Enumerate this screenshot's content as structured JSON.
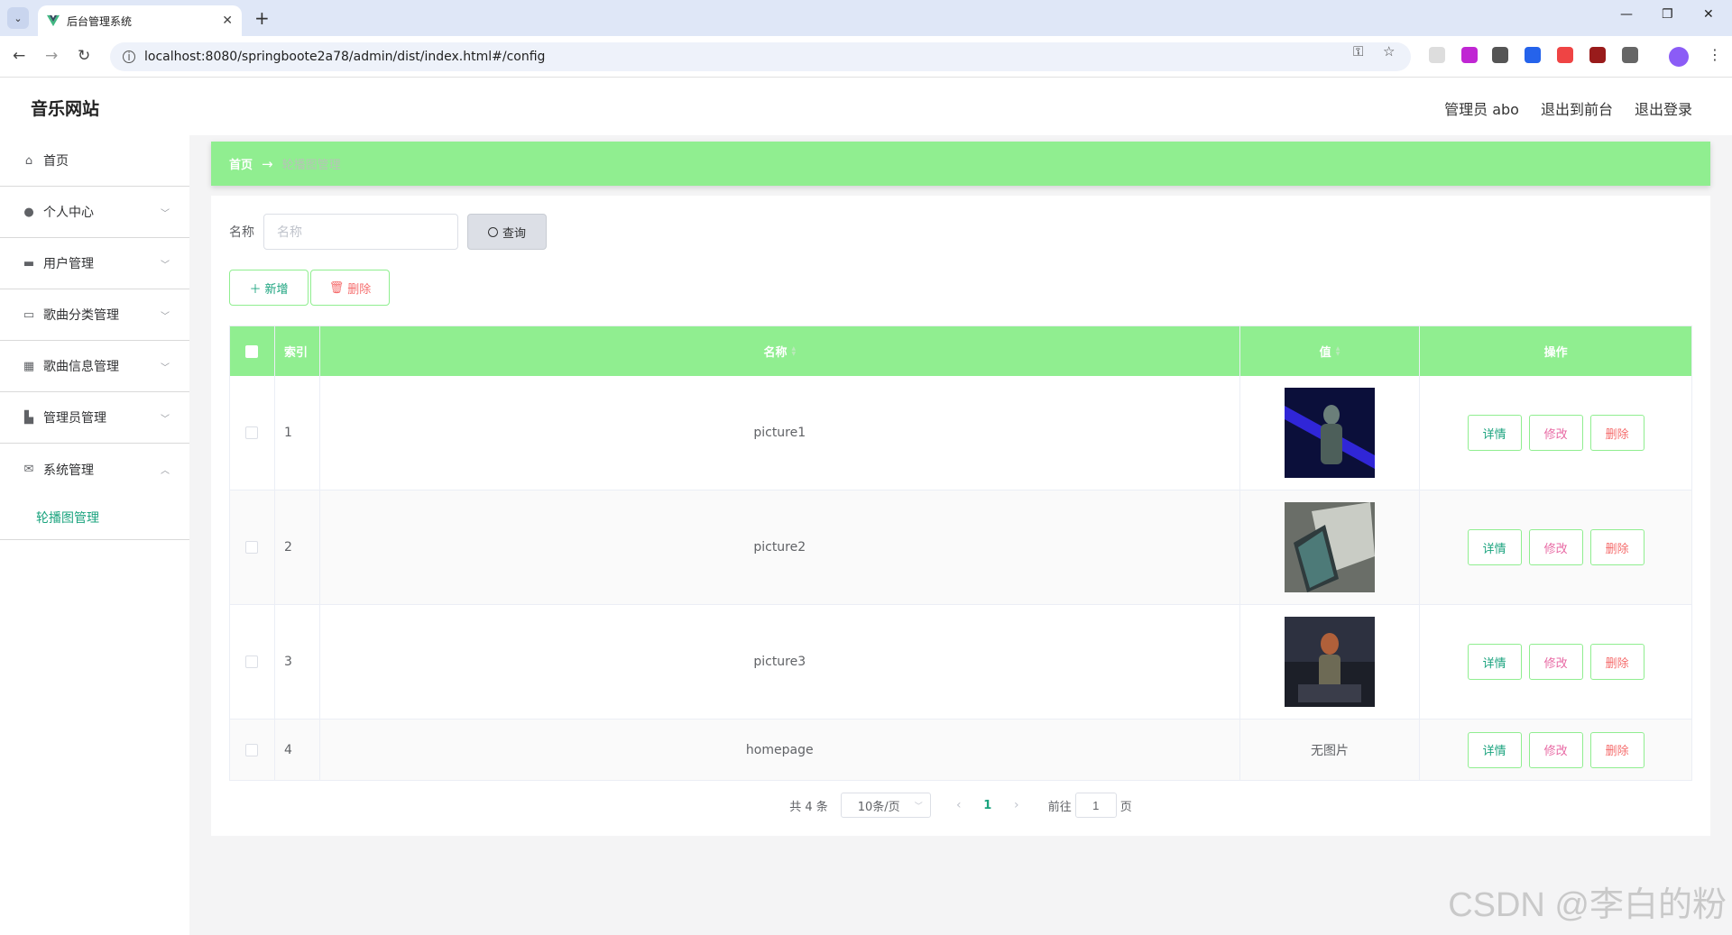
{
  "browser": {
    "tab_title": "后台管理系统",
    "url": "localhost:8080/springboote2a78/admin/dist/index.html#/config"
  },
  "header": {
    "brand": "音乐网站",
    "admin_label": "管理员 abo",
    "back_front": "退出到前台",
    "logout": "退出登录"
  },
  "sidebar": {
    "items": [
      {
        "label": "首页",
        "icon": "home-icon"
      },
      {
        "label": "个人中心",
        "icon": "user-icon"
      },
      {
        "label": "用户管理",
        "icon": "briefcase-icon"
      },
      {
        "label": "歌曲分类管理",
        "icon": "device-icon"
      },
      {
        "label": "歌曲信息管理",
        "icon": "grid-icon"
      },
      {
        "label": "管理员管理",
        "icon": "camera-icon"
      },
      {
        "label": "系统管理",
        "icon": "message-icon"
      }
    ],
    "submenu": {
      "label": "轮播图管理"
    }
  },
  "breadcrumb": {
    "home": "首页",
    "separator": "→",
    "current": "轮播图管理"
  },
  "search": {
    "label": "名称",
    "placeholder": "名称",
    "button": "查询"
  },
  "actions": {
    "add": "新增",
    "delete": "删除"
  },
  "table": {
    "headers": {
      "index": "索引",
      "name": "名称",
      "value": "值",
      "op": "操作"
    },
    "rows": [
      {
        "index": "1",
        "name": "picture1"
      },
      {
        "index": "2",
        "name": "picture2"
      },
      {
        "index": "3",
        "name": "picture3"
      },
      {
        "index": "4",
        "name": "homepage",
        "value": "无图片"
      }
    ],
    "row_actions": {
      "detail": "详情",
      "edit": "修改",
      "remove": "删除"
    }
  },
  "pagination": {
    "total": "共 4 条",
    "page_size": "10条/页",
    "current": "1",
    "goto_prefix": "前往",
    "goto_value": "1",
    "goto_suffix": "页"
  },
  "watermark": "CSDN @李白的粉",
  "colors": {
    "accent_green": "#90ee90",
    "text_green": "#1aa37e",
    "danger": "#f56c6c"
  }
}
